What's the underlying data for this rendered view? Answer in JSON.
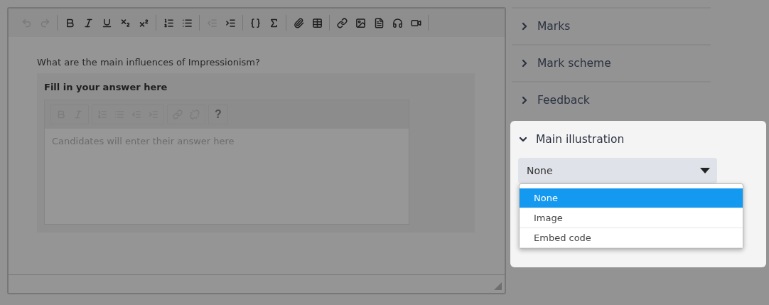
{
  "toolbar": {
    "groups": [
      [
        {
          "disabled": true
        },
        {
          "disabled": true
        }
      ],
      [
        {
          "disabled": false
        },
        {
          "disabled": false
        },
        {
          "disabled": false
        },
        {
          "disabled": false
        },
        {
          "disabled": false
        }
      ],
      [
        {
          "disabled": false
        },
        {
          "disabled": false
        }
      ],
      [
        {
          "disabled": true
        },
        {
          "disabled": false
        }
      ],
      [
        {
          "disabled": false
        },
        {
          "disabled": false
        }
      ],
      [
        {
          "disabled": false
        },
        {
          "disabled": false
        }
      ],
      [
        {
          "disabled": false
        },
        {
          "disabled": false
        },
        {
          "disabled": false
        },
        {
          "disabled": false
        },
        {
          "disabled": false
        }
      ]
    ]
  },
  "question": "What are the main influences of Impressionism?",
  "answer": {
    "title": "Fill in your answer here",
    "placeholder": "Candidates will enter their answer here",
    "help_label": "?",
    "toolbar": [
      {
        "disabled": true
      },
      {
        "disabled": true
      },
      {
        "disabled": true
      },
      {
        "disabled": true
      },
      {
        "disabled": true
      },
      {
        "disabled": true
      },
      {
        "disabled": true
      },
      {
        "disabled": true
      }
    ]
  },
  "sections": [
    {
      "label": "Marks",
      "expanded": false
    },
    {
      "label": "Mark scheme",
      "expanded": false
    },
    {
      "label": "Feedback",
      "expanded": false
    },
    {
      "label": "Main illustration",
      "expanded": true
    }
  ],
  "illustration_select": {
    "value": "None",
    "options": [
      {
        "label": "None",
        "selected": true
      },
      {
        "label": "Image",
        "selected": false
      },
      {
        "label": "Embed code",
        "selected": false
      }
    ]
  }
}
